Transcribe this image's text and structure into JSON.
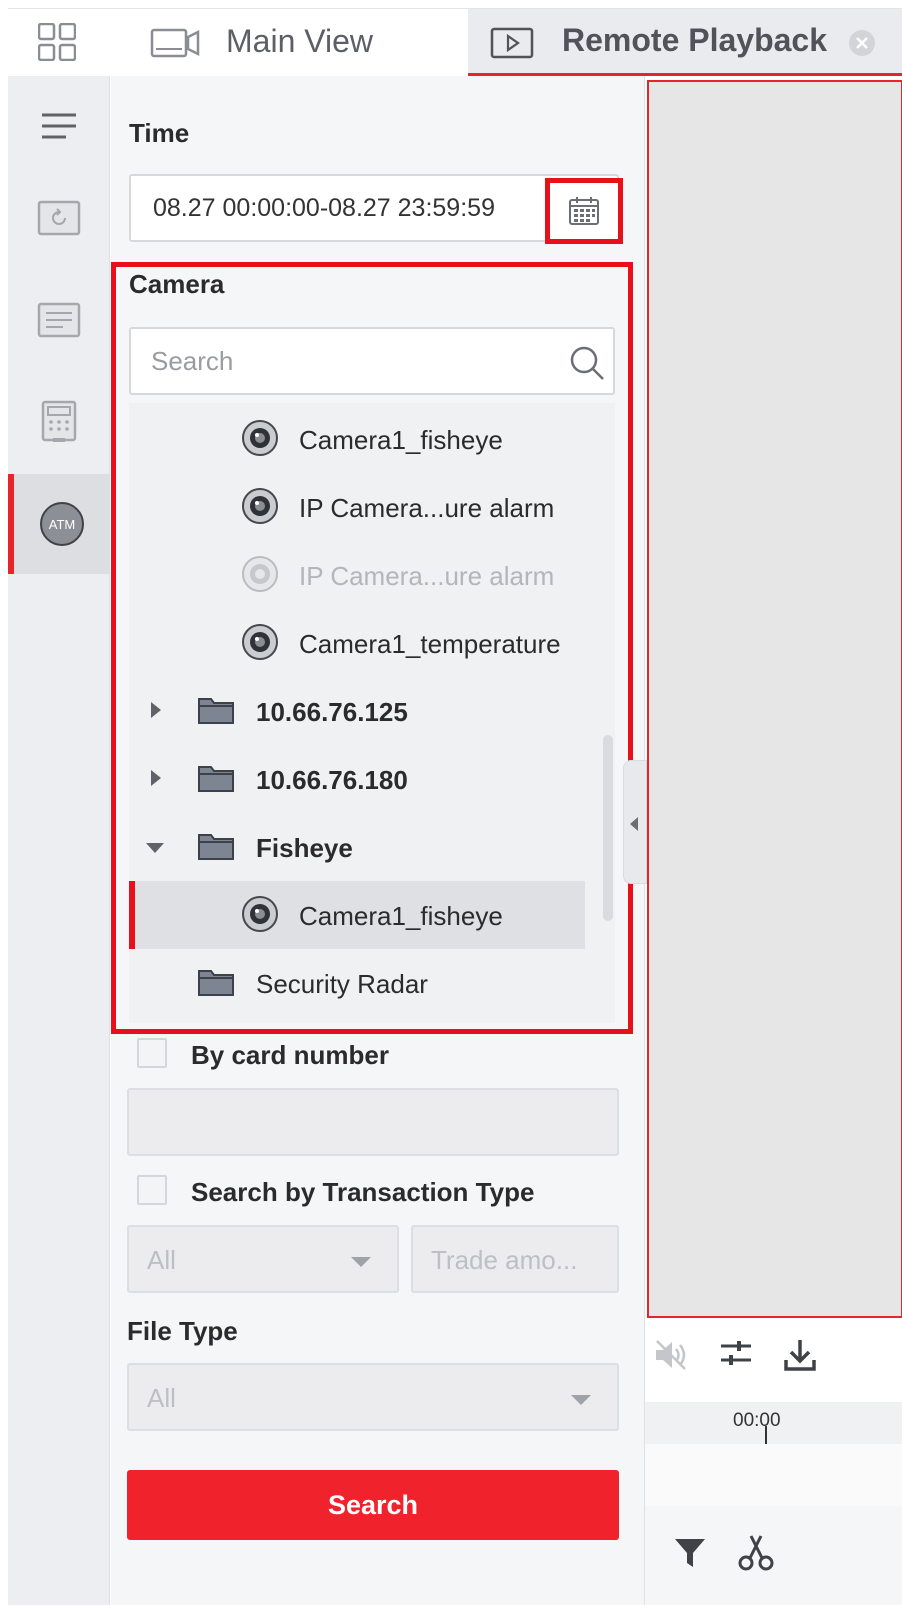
{
  "tabs": {
    "main_view": "Main View",
    "remote_playback": "Remote Playback"
  },
  "rail": {
    "atm_label": "ATM"
  },
  "panel": {
    "time_label": "Time",
    "time_value": "08.27 00:00:00-08.27 23:59:59",
    "camera_label": "Camera",
    "camera_search_placeholder": "Search",
    "tree": [
      {
        "label": "Camera1_fisheye",
        "kind": "camera",
        "state": "normal"
      },
      {
        "label": "IP Camera...ure alarm",
        "kind": "camera",
        "state": "normal"
      },
      {
        "label": "IP Camera...ure alarm",
        "kind": "camera",
        "state": "disabled"
      },
      {
        "label": "Camera1_temperature",
        "kind": "camera",
        "state": "normal"
      },
      {
        "label": "10.66.76.125",
        "kind": "group",
        "state": "collapsed"
      },
      {
        "label": "10.66.76.180",
        "kind": "group",
        "state": "collapsed"
      },
      {
        "label": "Fisheye",
        "kind": "group",
        "state": "expanded"
      },
      {
        "label": "Camera1_fisheye",
        "kind": "camera",
        "state": "selected"
      },
      {
        "label": "Security Radar",
        "kind": "group",
        "state": "normal"
      }
    ],
    "by_card_number_label": "By card number",
    "card_number_value": "",
    "transaction_type_label": "Search by Transaction Type",
    "transaction_type_value": "All",
    "trade_amount_placeholder": "Trade amo...",
    "file_type_label": "File Type",
    "file_type_value": "All",
    "search_button": "Search"
  },
  "preview": {
    "timeline_time": "00:00"
  },
  "colors": {
    "accent_red": "#e8101a",
    "search_button": "#f0222b"
  }
}
